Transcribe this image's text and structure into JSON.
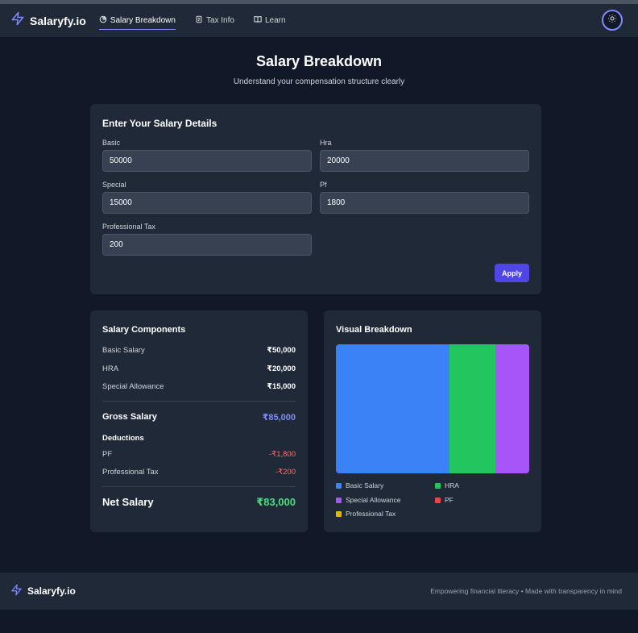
{
  "app": {
    "brand": "Salaryfy.io"
  },
  "nav": {
    "items": [
      {
        "label": "Salary Breakdown",
        "active": true,
        "icon": "pie-chart-icon"
      },
      {
        "label": "Tax Info",
        "active": false,
        "icon": "document-icon"
      },
      {
        "label": "Learn",
        "active": false,
        "icon": "book-icon"
      }
    ],
    "theme_toggle_icon": "sun-icon"
  },
  "page": {
    "title": "Salary Breakdown",
    "subtitle": "Understand your compensation structure clearly"
  },
  "form": {
    "title": "Enter Your Salary Details",
    "fields": [
      {
        "label": "Basic",
        "value": "50000"
      },
      {
        "label": "Hra",
        "value": "20000"
      },
      {
        "label": "Special",
        "value": "15000"
      },
      {
        "label": "Pf",
        "value": "1800"
      },
      {
        "label": "Professional Tax",
        "value": "200"
      }
    ],
    "apply_label": "Apply"
  },
  "components": {
    "title": "Salary Components",
    "earnings": [
      {
        "label": "Basic Salary",
        "value": "₹50,000"
      },
      {
        "label": "HRA",
        "value": "₹20,000"
      },
      {
        "label": "Special Allowance",
        "value": "₹15,000"
      }
    ],
    "gross": {
      "label": "Gross Salary",
      "value": "₹85,000"
    },
    "deductions_title": "Deductions",
    "deductions": [
      {
        "label": "PF",
        "value": "-₹1,800"
      },
      {
        "label": "Professional Tax",
        "value": "-₹200"
      }
    ],
    "net": {
      "label": "Net Salary",
      "value": "₹83,000"
    }
  },
  "visual": {
    "title": "Visual Breakdown",
    "segments": [
      {
        "name": "Basic Salary",
        "amount": 50000,
        "color": "#3b82f6"
      },
      {
        "name": "HRA",
        "amount": 20000,
        "color": "#22c55e"
      },
      {
        "name": "Special Allowance",
        "amount": 15000,
        "color": "#a855f7"
      },
      {
        "name": "PF",
        "amount": 1800,
        "color": "#ef4444"
      },
      {
        "name": "Professional Tax",
        "amount": 200,
        "color": "#eab308"
      }
    ]
  },
  "footer": {
    "brand": "Salaryfy.io",
    "tagline": "Empowering financial literacy • Made with transparency in mind"
  }
}
